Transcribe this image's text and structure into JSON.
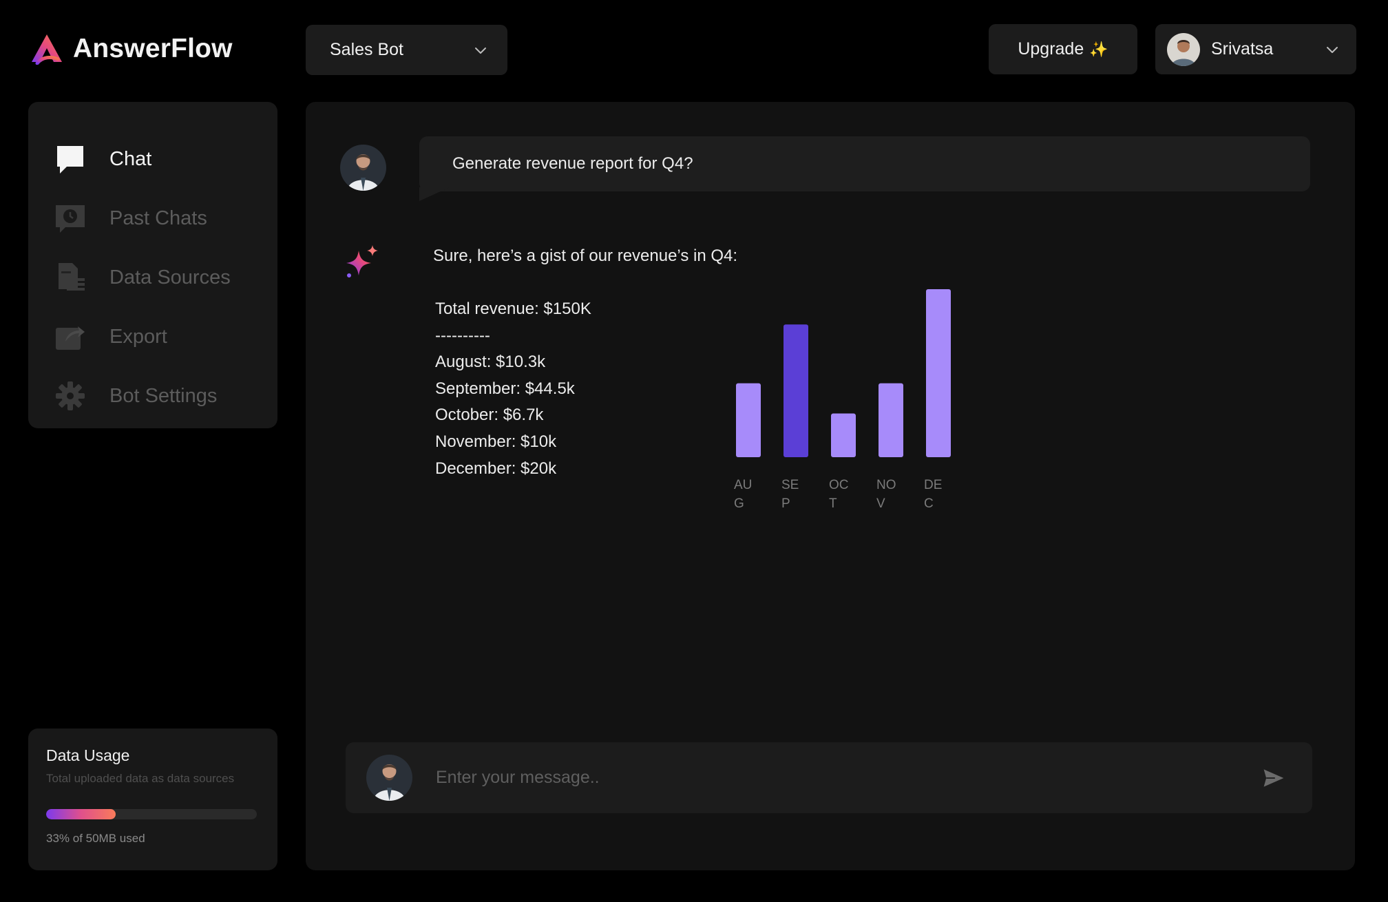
{
  "app": {
    "name": "AnswerFlow"
  },
  "header": {
    "bot_selector": {
      "value": "Sales Bot"
    },
    "upgrade": {
      "label": "Upgrade",
      "icon": "sparkles-icon"
    },
    "user": {
      "name": "Srivatsa"
    }
  },
  "sidebar": {
    "items": [
      {
        "label": "Chat",
        "icon": "chat-bubble-icon",
        "active": true
      },
      {
        "label": "Past Chats",
        "icon": "history-icon",
        "active": false
      },
      {
        "label": "Data Sources",
        "icon": "document-icon",
        "active": false
      },
      {
        "label": "Export",
        "icon": "export-icon",
        "active": false
      },
      {
        "label": "Bot Settings",
        "icon": "gear-icon",
        "active": false
      }
    ]
  },
  "usage": {
    "title": "Data Usage",
    "subtitle": "Total uploaded data as data sources",
    "percent": 33,
    "caption": "33% of 50MB used"
  },
  "conversation": {
    "user_message": "Generate revenue report for Q4?",
    "bot_intro": "Sure, here’s a gist of our revenue’s in Q4:",
    "report_lines": [
      "Total revenue: $150K",
      "----------",
      "August: $10.3k",
      "September: $44.5k",
      "October: $6.7k",
      "November: $10k",
      "December: $20k"
    ]
  },
  "chart_data": {
    "type": "bar",
    "categories": [
      "AU\nG",
      "SE\nP",
      "OC\nT",
      "NO\nV",
      "DE\nC"
    ],
    "values": [
      10.3,
      44.5,
      6.7,
      10,
      20
    ],
    "bar_heights_relative": [
      0.44,
      0.79,
      0.26,
      0.44,
      1.0
    ],
    "highlight_index": 1,
    "colors": {
      "bar": "#a78bfa",
      "highlight": "#5b3fd6"
    },
    "grid": false,
    "title": "",
    "xlabel": "",
    "ylabel": ""
  },
  "composer": {
    "placeholder": "Enter your message.."
  },
  "colors": {
    "background": "#000000",
    "panel": "#121212",
    "card": "#181818",
    "accent": "#a78bfa"
  }
}
